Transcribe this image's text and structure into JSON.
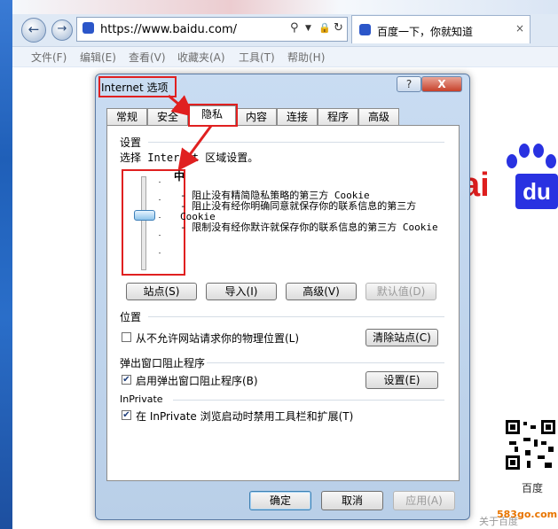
{
  "browser": {
    "url": "https://www.baidu.com/",
    "tab_title": "百度一下，你就知道",
    "tab_close": "×",
    "back_icon": "back-arrow-icon",
    "forward_icon": "forward-arrow-icon",
    "menu": [
      "文件(F)",
      "编辑(E)",
      "查看(V)",
      "收藏夹(A)",
      "工具(T)",
      "帮助(H)"
    ]
  },
  "page": {
    "logo_ai": "ai",
    "logo_du": "du",
    "qr_label": "百度",
    "footer_text": "关于百度",
    "watermark": "583go.com"
  },
  "dialog": {
    "title": "Internet 选项",
    "help_label": "?",
    "close_label": "X",
    "tabs": [
      "常规",
      "安全",
      "隐私",
      "内容",
      "连接",
      "程序",
      "高级"
    ],
    "active_tab": "隐私",
    "settings": {
      "group_label": "设置",
      "zone_text": "选择 Internet 区域设置。",
      "level": "中",
      "slider_level_fraction": 0.6,
      "desc_lines": [
        "- 阻止没有精简隐私策略的第三方 Cookie",
        "- 阻止没有经你明确同意就保存你的联系信息的第三方 Cookie",
        "- 限制没有经你默许就保存你的联系信息的第三方 Cookie"
      ],
      "buttons": {
        "sites": "站点(S)",
        "import": "导入(I)",
        "advanced": "高级(V)",
        "default": "默认值(D)"
      }
    },
    "location": {
      "group_label": "位置",
      "checkbox_label": "从不允许网站请求你的物理位置(L)",
      "checked": false,
      "clear_button": "清除站点(C)"
    },
    "popup": {
      "group_label": "弹出窗口阻止程序",
      "checkbox_label": "启用弹出窗口阻止程序(B)",
      "checked": true,
      "settings_button": "设置(E)"
    },
    "inprivate": {
      "group_label": "InPrivate",
      "checkbox_label": "在 InPrivate 浏览启动时禁用工具栏和扩展(T)",
      "checked": true
    },
    "footer": {
      "ok": "确定",
      "cancel": "取消",
      "apply": "应用(A)"
    }
  },
  "annotation_color": "#e02020"
}
